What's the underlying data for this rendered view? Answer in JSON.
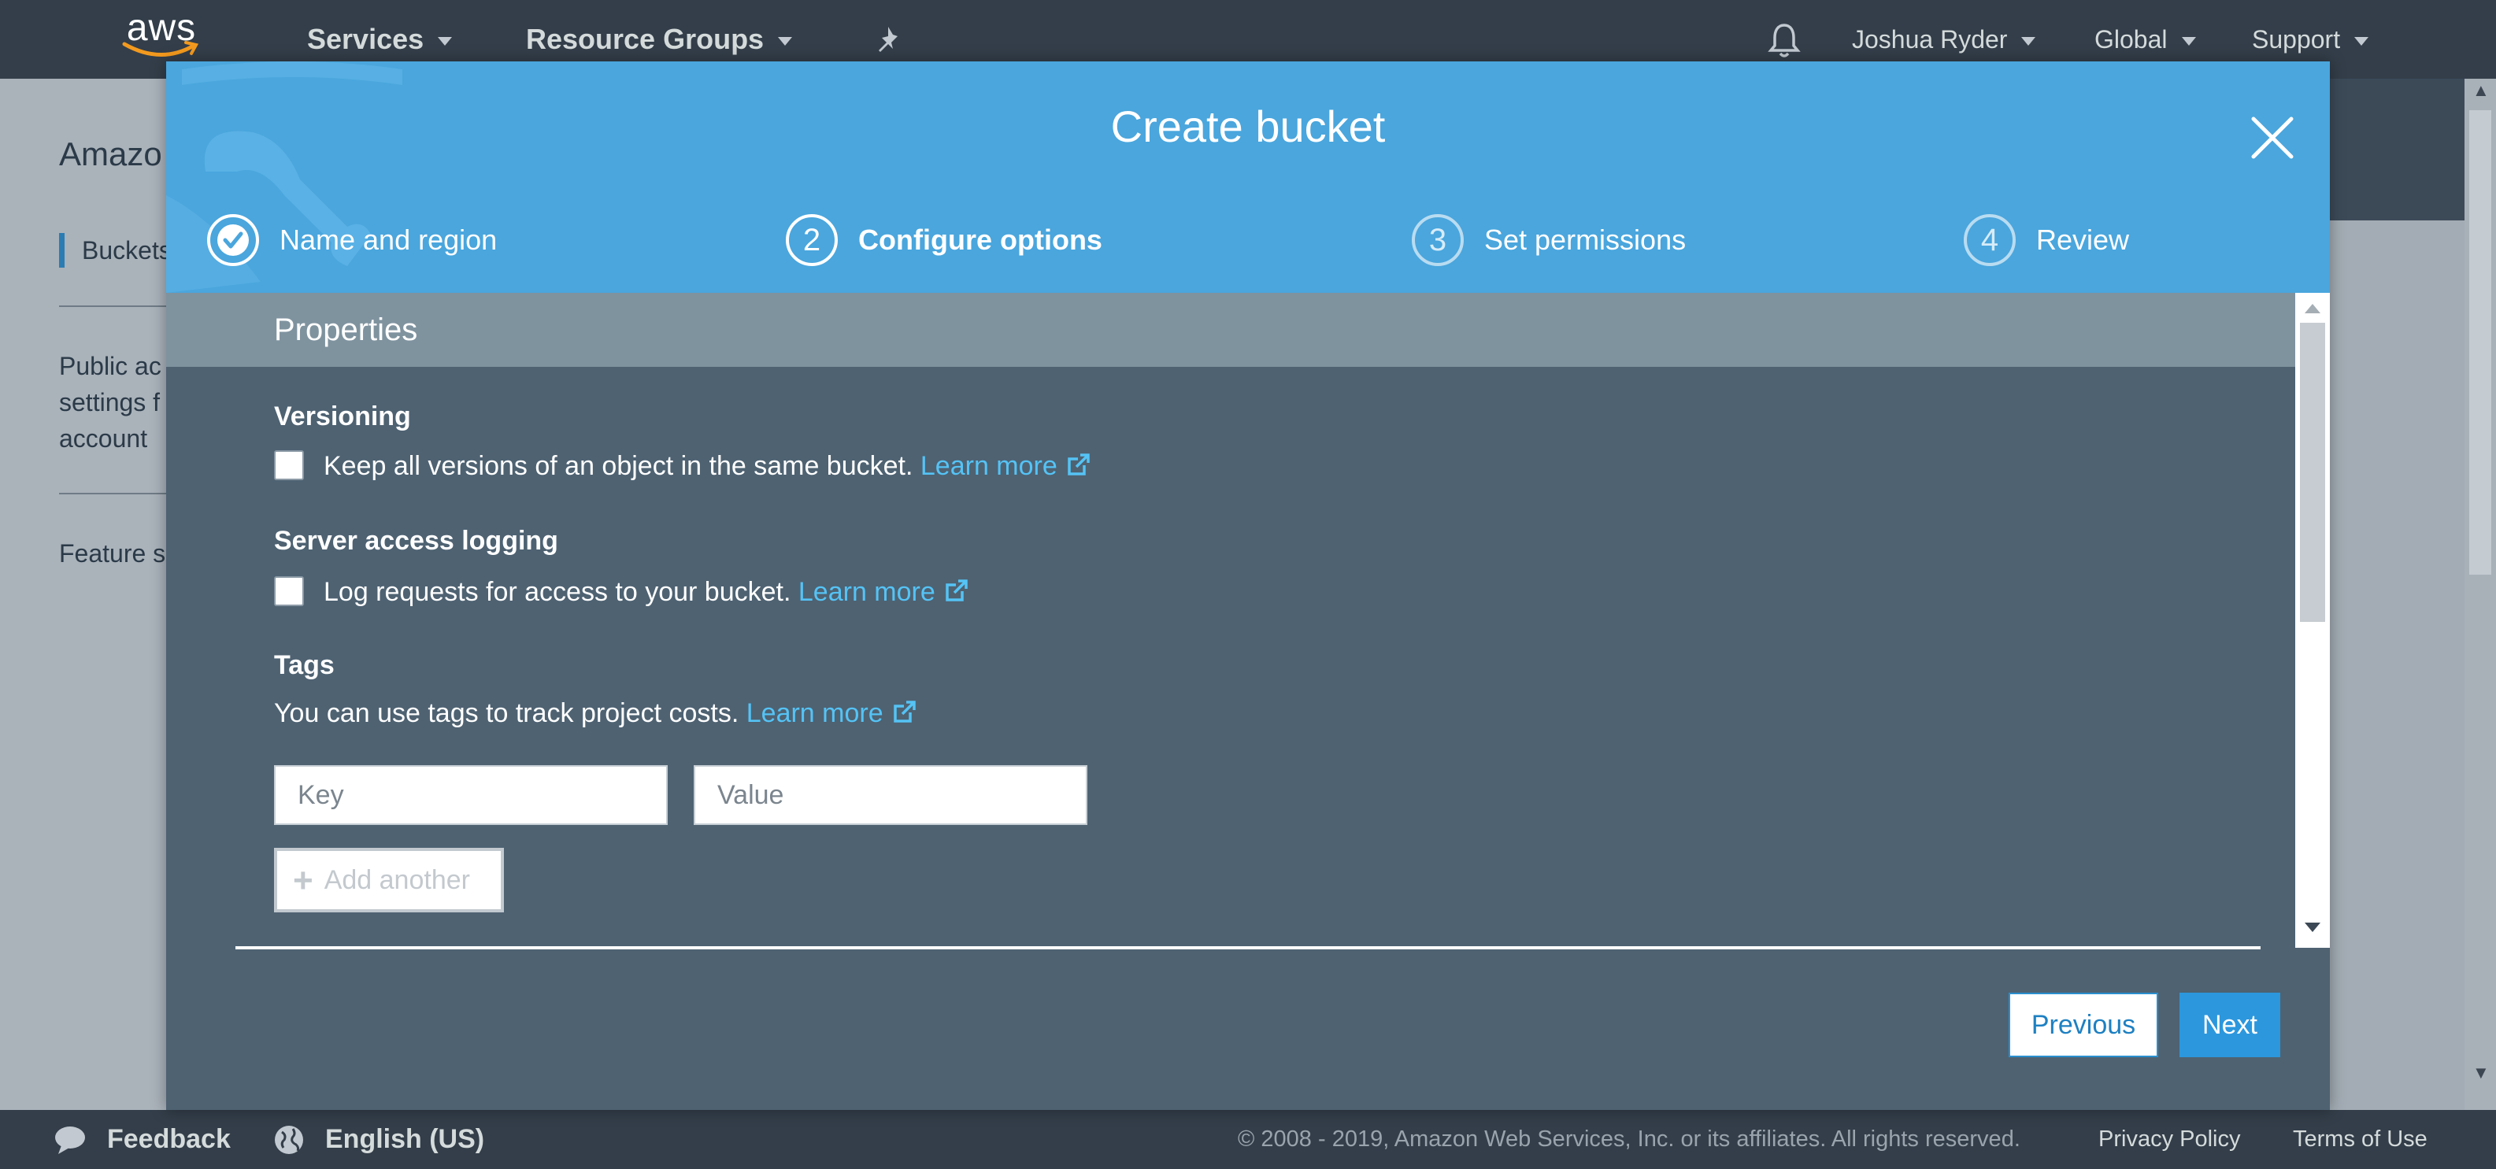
{
  "topnav": {
    "logo_text": "aws",
    "services": "Services",
    "resource_groups": "Resource Groups",
    "user": "Joshua Ryder",
    "region": "Global",
    "support": "Support"
  },
  "background_page": {
    "title": "Amazo",
    "buckets": "Buckets",
    "public_access_lines": [
      "Public ac",
      "settings f",
      "account"
    ],
    "feature": "Feature s"
  },
  "modal": {
    "title": "Create bucket",
    "steps": [
      {
        "number": "",
        "label": "Name and region",
        "state": "complete"
      },
      {
        "number": "2",
        "label": "Configure options",
        "state": "current"
      },
      {
        "number": "3",
        "label": "Set permissions",
        "state": "upcoming"
      },
      {
        "number": "4",
        "label": "Review",
        "state": "upcoming"
      }
    ],
    "section_header": "Properties",
    "versioning": {
      "title": "Versioning",
      "text": "Keep all versions of an object in the same bucket.",
      "link": "Learn more",
      "checked": false
    },
    "logging": {
      "title": "Server access logging",
      "text": "Log requests for access to your bucket.",
      "link": "Learn more",
      "checked": false
    },
    "tags": {
      "title": "Tags",
      "text": "You can use tags to track project costs.",
      "link": "Learn more",
      "key_placeholder": "Key",
      "value_placeholder": "Value",
      "add_label": "Add another"
    },
    "previous_label": "Previous",
    "next_label": "Next"
  },
  "footer": {
    "feedback": "Feedback",
    "language": "English (US)",
    "copyright": "© 2008 - 2019, Amazon Web Services, Inc. or its affiliates. All rights reserved.",
    "privacy": "Privacy Policy",
    "terms": "Terms of Use"
  },
  "colors": {
    "nav_bg": "#333e4a",
    "modal_header": "#4aa6dd",
    "modal_body": "#4e6272",
    "link": "#55c3f5",
    "primary_button": "#2c97dd"
  }
}
